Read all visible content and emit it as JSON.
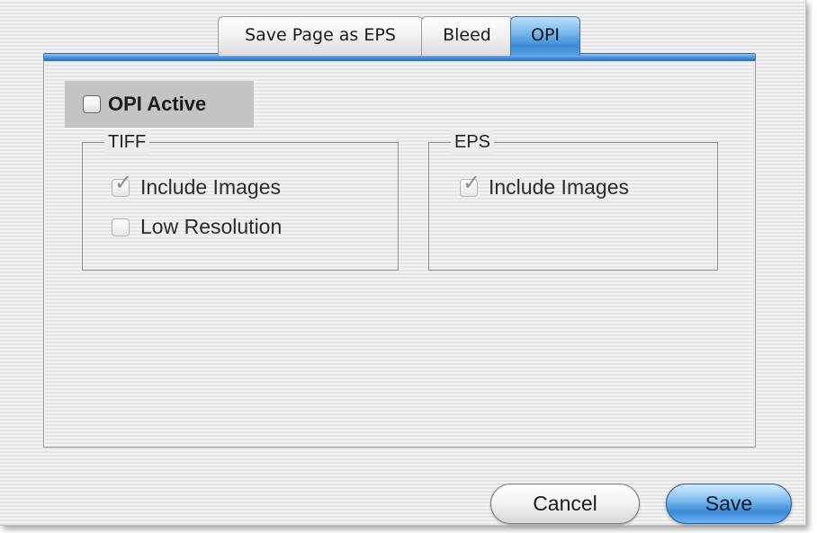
{
  "tabs": [
    {
      "label": "Save Page as EPS",
      "active": false
    },
    {
      "label": "Bleed",
      "active": false
    },
    {
      "label": "OPI",
      "active": true
    }
  ],
  "opi_active": {
    "label": "OPI Active",
    "checked": false
  },
  "tiff_group": {
    "title": "TIFF",
    "options": [
      {
        "label": "Include Images",
        "checked": true,
        "enabled": false
      },
      {
        "label": "Low Resolution",
        "checked": false,
        "enabled": false
      }
    ]
  },
  "eps_group": {
    "title": "EPS",
    "options": [
      {
        "label": "Include Images",
        "checked": true,
        "enabled": false
      }
    ]
  },
  "buttons": {
    "cancel_label": "Cancel",
    "save_label": "Save"
  },
  "colors": {
    "accent": "#3b8ad8",
    "window_bg": "#ececec"
  }
}
